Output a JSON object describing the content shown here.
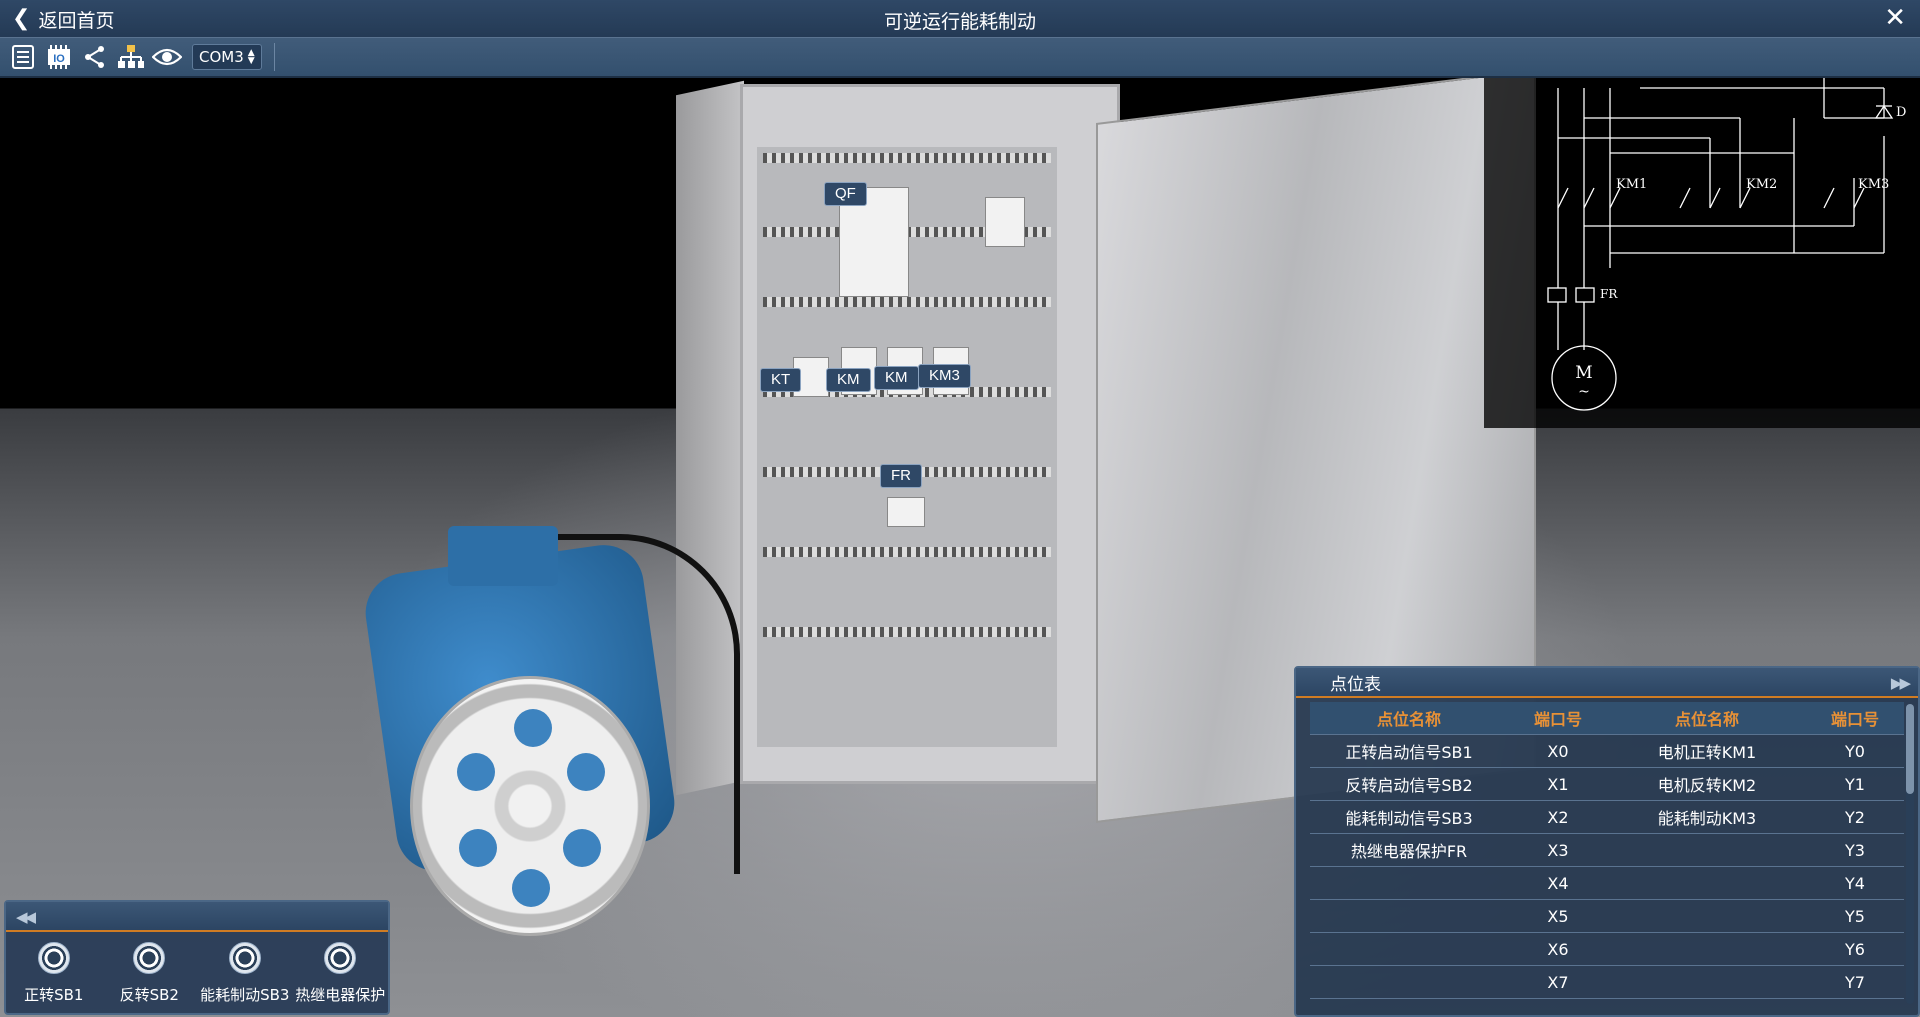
{
  "titlebar": {
    "back_label": "返回首页",
    "title": "可逆运行能耗制动",
    "close_symbol": "✕"
  },
  "toolbar": {
    "icons": [
      "list-icon",
      "io-module-icon",
      "share-icon",
      "network-icon",
      "eye-icon"
    ],
    "io_text": "IO",
    "port_select": "COM3"
  },
  "scene": {
    "tags": {
      "qf": "QF",
      "kt": "KT",
      "km1": "KM",
      "km2": "KM",
      "km3": "KM3",
      "fr": "FR"
    }
  },
  "schematic": {
    "labels": {
      "km1": "KM1",
      "km2": "KM2",
      "km3": "KM3",
      "diode": "D",
      "fr": "FR",
      "motor": "M",
      "motor_sub": "~"
    }
  },
  "point_table": {
    "title": "点位表",
    "headers": [
      "点位名称",
      "端口号",
      "点位名称",
      "端口号"
    ],
    "rows": [
      [
        "正转启动信号SB1",
        "X0",
        "电机正转KM1",
        "Y0"
      ],
      [
        "反转启动信号SB2",
        "X1",
        "电机反转KM2",
        "Y1"
      ],
      [
        "能耗制动信号SB3",
        "X2",
        "能耗制动KM3",
        "Y2"
      ],
      [
        "热继电器保护FR",
        "X3",
        "",
        "Y3"
      ],
      [
        "",
        "X4",
        "",
        "Y4"
      ],
      [
        "",
        "X5",
        "",
        "Y5"
      ],
      [
        "",
        "X6",
        "",
        "Y6"
      ],
      [
        "",
        "X7",
        "",
        "Y7"
      ]
    ]
  },
  "control_panel": {
    "buttons": [
      "正转SB1",
      "反转SB2",
      "能耗制动SB3",
      "热继电器保护"
    ]
  },
  "colors": {
    "accent_orange": "#e89136",
    "panel_blue": "#2f4866"
  }
}
